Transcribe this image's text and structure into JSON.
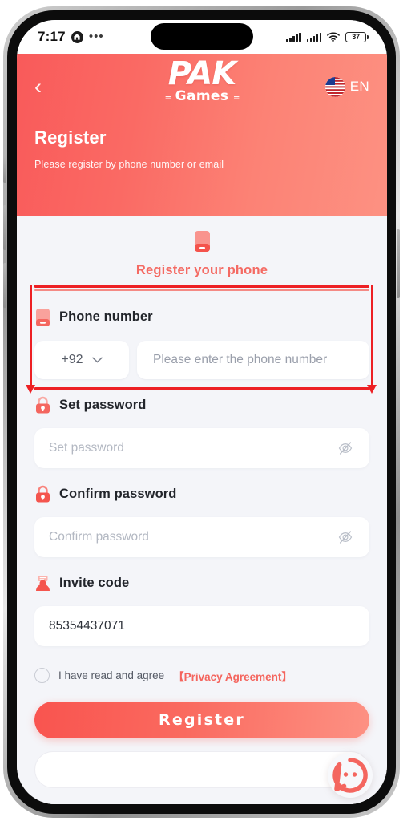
{
  "status_bar": {
    "time": "7:17",
    "dots": "•••",
    "battery_level": "37",
    "icons": [
      "app-badge-icon",
      "more-dots-icon",
      "signal-bars-icon",
      "signal-bars-icon",
      "wifi-icon",
      "battery-icon"
    ]
  },
  "header": {
    "back_icon": "‹",
    "logo_main": "PAK",
    "logo_sub": "Games",
    "logo_bar_left": "≡",
    "logo_bar_right": "≡",
    "language": "EN",
    "flag": "us-flag-icon",
    "title": "Register",
    "subtitle": "Please register by phone number or email",
    "gradient_from": "#f95a5a",
    "gradient_to": "#fd9182"
  },
  "tab": {
    "icon": "phone-icon",
    "label": "Register your phone",
    "accent_color": "#f46a63"
  },
  "fields": {
    "phone": {
      "icon": "phone-icon",
      "label": "Phone number",
      "country_code": "+92",
      "chevron": "chevron-down-icon",
      "placeholder": "Please enter the phone number",
      "value": ""
    },
    "set_password": {
      "icon": "lock-icon",
      "label": "Set password",
      "placeholder": "Set password",
      "value": "",
      "toggle_icon": "eye-off-icon"
    },
    "confirm_password": {
      "icon": "lock-icon",
      "label": "Confirm password",
      "placeholder": "Confirm password",
      "value": "",
      "toggle_icon": "eye-off-icon"
    },
    "invite_code": {
      "icon": "invite-card-icon",
      "label": "Invite code",
      "placeholder": "",
      "value": "85354437071"
    }
  },
  "agreement": {
    "checked": false,
    "text": "I have read and agree",
    "link": "【Privacy Agreement】",
    "link_color": "#f4655e"
  },
  "actions": {
    "register_label": "Register"
  },
  "support": {
    "icon": "chat-support-icon"
  },
  "annotation": {
    "color": "#ed2024",
    "shape": "rectangle-with-down-arrows",
    "target": "phone-number-field"
  }
}
